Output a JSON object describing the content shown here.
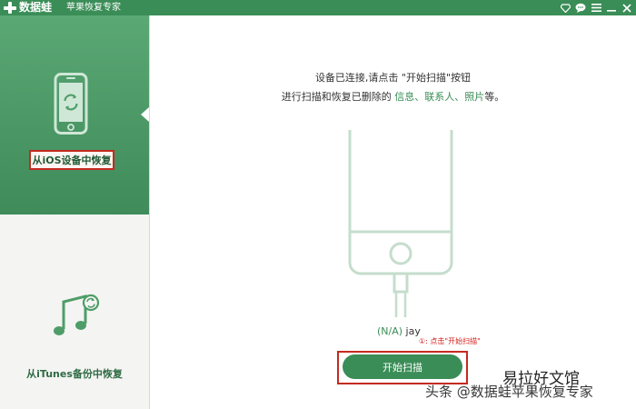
{
  "titlebar": {
    "app_name": "数据蛙",
    "subtitle": "苹果恢复专家",
    "icons": [
      "diamond-icon",
      "chat-icon",
      "menu-icon",
      "minimize-icon",
      "close-icon"
    ]
  },
  "sidebar": {
    "items": [
      {
        "label": "从iOS设备中恢复",
        "icon": "phone-icon",
        "active": true
      },
      {
        "label": "从iTunes备份中恢复",
        "icon": "music-icon",
        "active": false
      }
    ]
  },
  "main": {
    "instruction_line1": "设备已连接,请点击 \"开始扫描\"按钮",
    "instruction_line2_prefix": "进行扫描和恢复已删除的 ",
    "highlight_items": [
      "信息",
      "联系人",
      "照片"
    ],
    "separator": "、",
    "instruction_line2_suffix": "等。",
    "device_status": "(N/A)",
    "device_name": "jay",
    "step_tip": "①: 点击\"开始扫描\"",
    "scan_button_label": "开始扫描"
  },
  "watermark": {
    "line1": "易拉好文馆",
    "line2": "头条 @数据蛙苹果恢复专家"
  },
  "colors": {
    "brand_green": "#3a8d57",
    "highlight_red": "#c52a1f"
  }
}
